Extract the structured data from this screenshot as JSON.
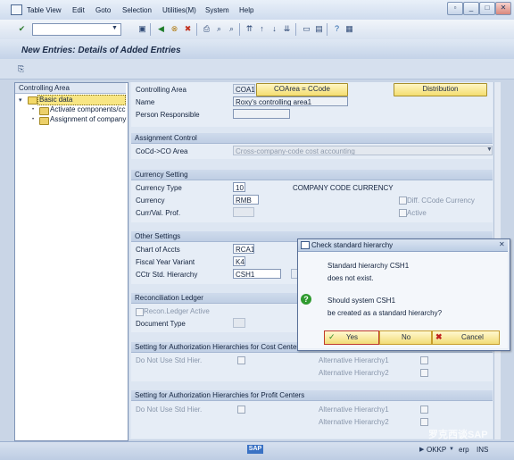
{
  "menubar": {
    "items": [
      "Table View",
      "Edit",
      "Goto",
      "Selection",
      "Utilities(M)",
      "System",
      "Help"
    ]
  },
  "title": "New Entries: Details of Added Entries",
  "tree": {
    "header": "Controlling Area",
    "items": [
      {
        "label": "Basic data",
        "selected": true
      },
      {
        "label": "Activate components/cc"
      },
      {
        "label": "Assignment of company"
      }
    ]
  },
  "top": {
    "controlling_area_label": "Controlling Area",
    "controlling_area_value": "COA1",
    "coarea_ccode_button": "COArea = CCode",
    "distribution_button": "Distribution",
    "name_label": "Name",
    "name_value": "Roxy's controlling area1",
    "person_label": "Person Responsible",
    "person_value": ""
  },
  "assignment": {
    "title": "Assignment Control",
    "coco_label": "CoCd->CO Area",
    "coco_value": "Cross-company-code cost accounting"
  },
  "currency": {
    "title": "Currency Setting",
    "type_label": "Currency Type",
    "type_value": "10",
    "type_text": "COMPANY CODE CURRENCY",
    "currency_label": "Currency",
    "currency_value": "RMB",
    "diff_label": "Diff. CCode Currency",
    "prof_label": "Curr/Val. Prof.",
    "prof_value": "",
    "active_label": "Active"
  },
  "other": {
    "title": "Other Settings",
    "chart_label": "Chart of Accts",
    "chart_value": "RCA1",
    "fyv_label": "Fiscal Year Variant",
    "fyv_value": "K4",
    "cctr_label": "CCtr Std. Hierarchy",
    "cctr_value": "CSH1"
  },
  "recon": {
    "title": "Reconciliation Ledger",
    "active_label": "Recon.Ledger Active",
    "doctype_label": "Document Type",
    "doctype_value": ""
  },
  "auth_cost": {
    "title": "Setting for Authorization Hierarchies for Cost Centers",
    "no_std_label": "Do Not Use Std Hier.",
    "alt1_label": "Alternative Hierarchy1",
    "alt2_label": "Alternative Hierarchy2"
  },
  "auth_profit": {
    "title": "Setting for Authorization Hierarchies for Profit Centers",
    "no_std_label": "Do Not Use Std Hier.",
    "alt1_label": "Alternative Hierarchy1",
    "alt2_label": "Alternative Hierarchy2"
  },
  "dialog": {
    "title": "Check standard hierarchy",
    "line1": "Standard hierarchy CSH1",
    "line2": "does not exist.",
    "line3": "Should system CSH1",
    "line4": "be created as a standard hierarchy?",
    "yes": "Yes",
    "no": "No",
    "cancel": "Cancel"
  },
  "status": {
    "sap_logo": "SAP",
    "server": "OKKP",
    "client": "erp",
    "mode": "INS",
    "watermark": "罗克西谈SAP"
  },
  "colors": {
    "accent_yellow": "#f4dd70",
    "panel": "#dde6f2",
    "dialog_ok": "#2f9a2f",
    "cancel_x": "#c0201f"
  }
}
